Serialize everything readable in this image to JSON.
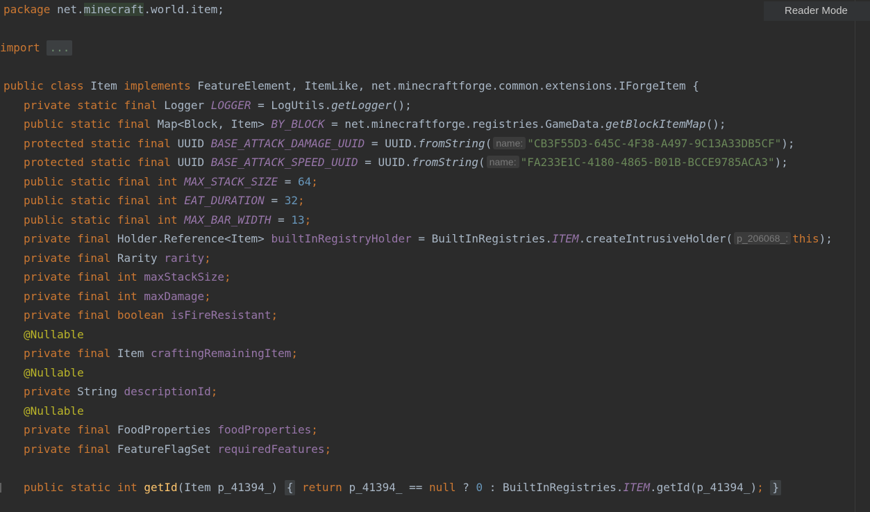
{
  "toolbar": {
    "reader_mode_label": "Reader Mode"
  },
  "code": {
    "package_kw": "package",
    "package_name_a": "net.",
    "package_name_b": "minecraft",
    "package_name_c": ".world.item;",
    "import_kw": "import",
    "import_fold": "...",
    "class_public": "public",
    "class_kw": "class",
    "class_name": "Item",
    "implements_kw": "implements",
    "implements_list": "FeatureElement, ItemLike, net.minecraftforge.common.extensions.IForgeItem {",
    "l1_mod": "private static final",
    "l1_type": "Logger",
    "l1_name": "LOGGER",
    "l1_rest_a": " = LogUtils.",
    "l1_method": "getLogger",
    "l1_rest_b": "();",
    "l2_mod": "public static final",
    "l2_type": "Map<Block, Item>",
    "l2_name": "BY_BLOCK",
    "l2_rest_a": " = net.minecraftforge.registries.GameData.",
    "l2_method": "getBlockItemMap",
    "l2_rest_b": "();",
    "l3_mod": "protected static final",
    "l3_type": "UUID",
    "l3_name": "BASE_ATTACK_DAMAGE_UUID",
    "l3_rest_a": " = UUID.",
    "l3_method": "fromString",
    "l3_hint": "name:",
    "l3_str": "\"CB3F55D3-645C-4F38-A497-9C13A33DB5CF\"",
    "l3_end": ");",
    "l4_mod": "protected static final",
    "l4_type": "UUID",
    "l4_name": "BASE_ATTACK_SPEED_UUID",
    "l4_rest_a": " = UUID.",
    "l4_method": "fromString",
    "l4_hint": "name:",
    "l4_str": "\"FA233E1C-4180-4865-B01B-BCCE9785ACA3\"",
    "l4_end": ");",
    "l5_mod": "public static final",
    "l5_type": "int",
    "l5_name": "MAX_STACK_SIZE",
    "l5_val": "64",
    "l6_mod": "public static final",
    "l6_type": "int",
    "l6_name": "EAT_DURATION",
    "l6_val": "32",
    "l7_mod": "public static final",
    "l7_type": "int",
    "l7_name": "MAX_BAR_WIDTH",
    "l7_val": "13",
    "l8_mod": "private final",
    "l8_type": "Holder.Reference<Item>",
    "l8_name": "builtInRegistryHolder",
    "l8_rest_a": " = BuiltInRegistries.",
    "l8_const": "ITEM",
    "l8_rest_b": ".createIntrusiveHolder(",
    "l8_hint": "p_206068_:",
    "l8_this": "this",
    "l8_end": ");",
    "l9_mod": "private final",
    "l9_type": "Rarity",
    "l9_name": "rarity",
    "l10_mod": "private final",
    "l10_type": "int",
    "l10_name": "maxStackSize",
    "l11_mod": "private final",
    "l11_type": "int",
    "l11_name": "maxDamage",
    "l12_mod": "private final",
    "l12_type": "boolean",
    "l12_name": "isFireResistant",
    "ann1": "@Nullable",
    "l13_mod": "private final",
    "l13_type": "Item",
    "l13_name": "craftingRemainingItem",
    "ann2": "@Nullable",
    "l14_mod": "private",
    "l14_type": "String",
    "l14_name": "descriptionId",
    "ann3": "@Nullable",
    "l15_mod": "private final",
    "l15_type": "FoodProperties",
    "l15_name": "foodProperties",
    "l16_mod": "private final",
    "l16_type": "FeatureFlagSet",
    "l16_name": "requiredFeatures",
    "m_mod": "public static",
    "m_type": "int",
    "m_name": "getId",
    "m_params": "(Item p_41394_)",
    "m_open": "{",
    "m_return": "return",
    "m_expr_a": " p_41394_ == ",
    "m_null": "null",
    "m_expr_b": " ? ",
    "m_zero": "0",
    "m_expr_c": " : BuiltInRegistries.",
    "m_const": "ITEM",
    "m_expr_d": ".getId(p_41394_)",
    "m_semi": ";",
    "m_close": "}"
  }
}
